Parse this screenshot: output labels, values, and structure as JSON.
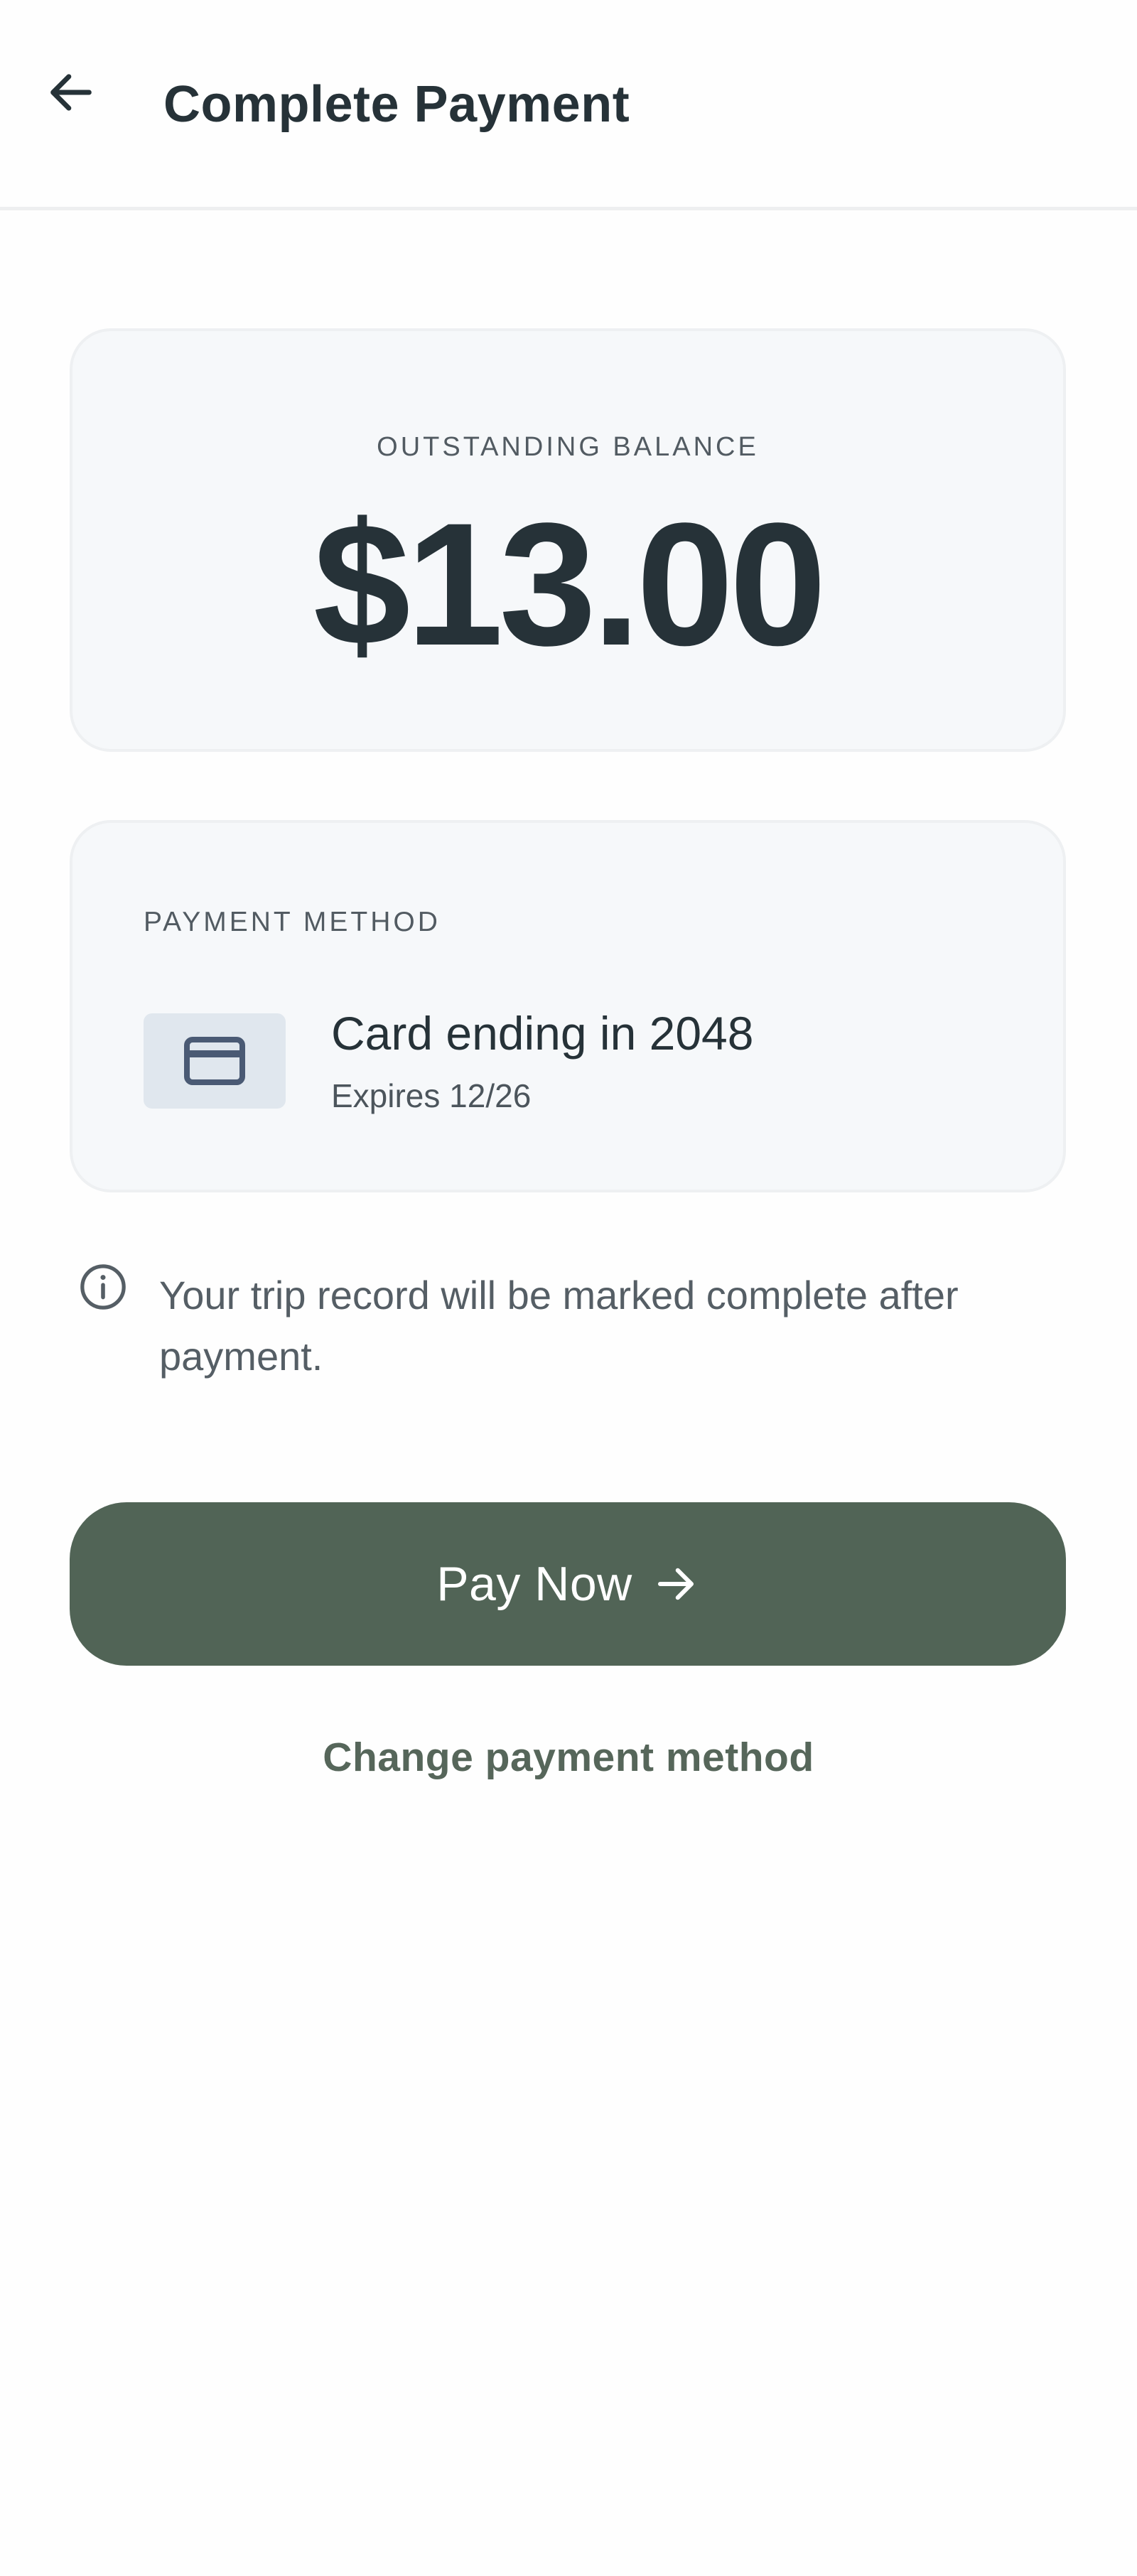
{
  "header": {
    "back_icon": "arrow-left-icon",
    "title": "Complete Payment"
  },
  "balance": {
    "label": "OUTSTANDING BALANCE",
    "amount": "$13.00"
  },
  "payment_method": {
    "label": "PAYMENT METHOD",
    "card_icon": "credit-card-icon",
    "card_name": "Card ending in 2048",
    "expiry": "Expires 12/26"
  },
  "note": {
    "icon": "info-icon",
    "text": "Your trip record will be marked complete after payment."
  },
  "actions": {
    "pay_label": "Pay Now",
    "pay_icon": "arrow-right-icon",
    "change_label": "Change payment method"
  },
  "colors": {
    "accent": "#516456",
    "text": "#263238",
    "card_bg": "#f6f8fa"
  }
}
